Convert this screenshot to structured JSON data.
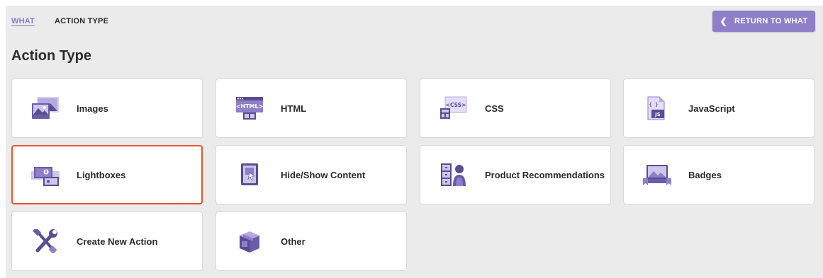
{
  "breadcrumb": {
    "parent": "WHAT",
    "current": "ACTION TYPE"
  },
  "header": {
    "return_label": "RETURN TO WHAT"
  },
  "page": {
    "title": "Action Type"
  },
  "cards": [
    {
      "label": "Images",
      "icon": "images-icon"
    },
    {
      "label": "HTML",
      "icon": "html-icon"
    },
    {
      "label": "CSS",
      "icon": "css-icon"
    },
    {
      "label": "JavaScript",
      "icon": "javascript-icon"
    },
    {
      "label": "Lightboxes",
      "icon": "lightboxes-icon",
      "selected": true
    },
    {
      "label": "Hide/Show Content",
      "icon": "hide-show-icon"
    },
    {
      "label": "Product Recommendations",
      "icon": "product-recommendations-icon"
    },
    {
      "label": "Badges",
      "icon": "badges-icon"
    },
    {
      "label": "Create New Action",
      "icon": "tools-icon"
    },
    {
      "label": "Other",
      "icon": "box-icon"
    }
  ],
  "icon_text": {
    "html": "<HTML>",
    "css": "<CSS>",
    "js_braces": "{ }",
    "js": "JS"
  },
  "colors": {
    "accent": "#8f7fc9",
    "icon_dark": "#5b4c92",
    "icon_light": "#cfc6ec",
    "selected_border": "#e8542f",
    "panel_bg": "#ebebeb"
  }
}
